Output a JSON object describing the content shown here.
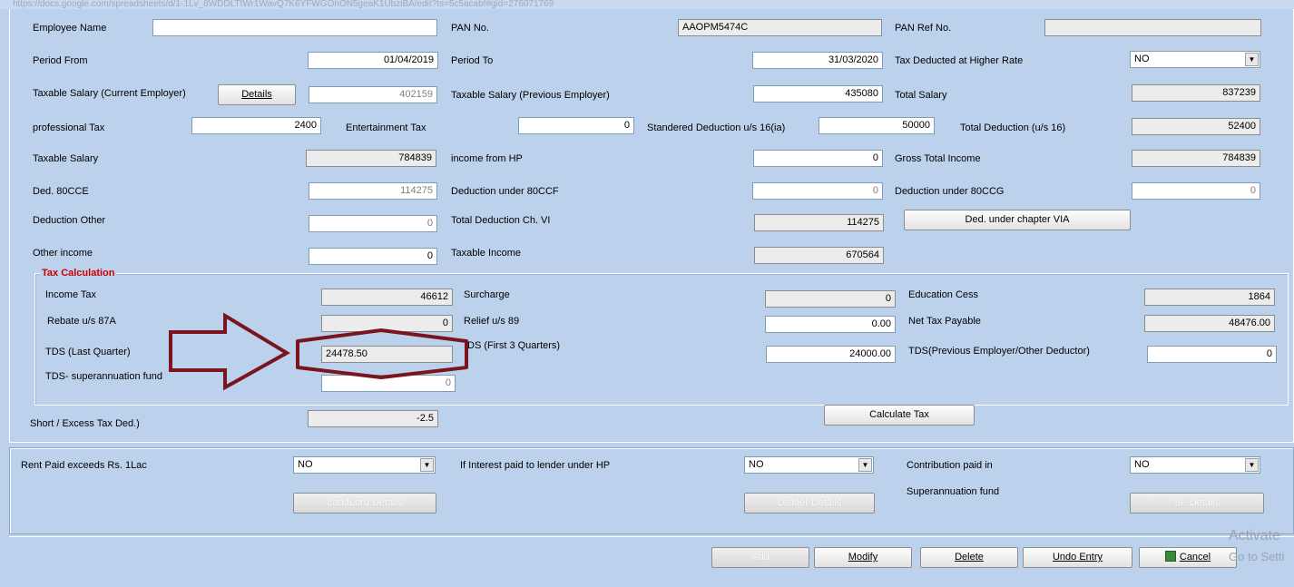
{
  "url": "https://docs.google.com/spreadsheets/d/1-1Lv_8WDDLTtWr1WavQ7K6YFWGOnON5geaK1UbziBA/edit?ts=5c5acabf#gid=276071769",
  "employee": {
    "name_label": "Employee Name",
    "name_value": "",
    "pan_label": "PAN No.",
    "pan_value": "AAOPM5474C",
    "pan_ref_label": "PAN Ref No.",
    "pan_ref_value": ""
  },
  "period": {
    "from_label": "Period From",
    "from_value": "01/04/2019",
    "to_label": "Period To",
    "to_value": "31/03/2020",
    "higher_rate_label": "Tax Deducted at Higher Rate",
    "higher_rate_value": "NO"
  },
  "salary": {
    "current_label": "Taxable Salary (Current Employer)",
    "details_button": "Details",
    "current_value": "402159",
    "previous_label": "Taxable Salary (Previous Employer)",
    "previous_value": "435080",
    "total_label": "Total Salary",
    "total_value": "837239"
  },
  "deductions16": {
    "prof_tax_label": "professional Tax",
    "prof_tax_value": "2400",
    "ent_tax_label": "Entertainment Tax",
    "ent_tax_value": "0",
    "std_label": "Standered Deduction u/s 16(ia)",
    "std_value": "50000",
    "total_label": "Total Deduction (u/s 16)",
    "total_value": "52400"
  },
  "income": {
    "taxable_salary_label": "Taxable Salary",
    "taxable_salary_value": "784839",
    "hp_label": "income from HP",
    "hp_value": "0",
    "gross_label": "Gross Total Income",
    "gross_value": "784839"
  },
  "chapter6": {
    "ccd_label": "Ded. 80CCE",
    "ccd_value": "114275",
    "ccf_label": "Deduction under 80CCF",
    "ccf_value": "0",
    "ccg_label": "Deduction under 80CCG",
    "ccg_value": "0",
    "other_label": "Deduction Other",
    "other_value": "0",
    "total_label": "Total Deduction Ch. VI",
    "total_value": "114275",
    "via_button": "Ded. under chapter VIA",
    "other_income_label": "Other income",
    "other_income_value": "0",
    "taxable_income_label": "Taxable Income",
    "taxable_income_value": "670564"
  },
  "tax_calc": {
    "title": "Tax Calculation",
    "income_tax_label": "Income Tax",
    "income_tax_value": "46612",
    "surcharge_label": "Surcharge",
    "surcharge_value": "0",
    "cess_label": "Education Cess",
    "cess_value": "1864",
    "rebate_label": "Rebate u/s 87A",
    "rebate_value": "0",
    "relief_label": "Relief u/s 89",
    "relief_value": "0.00",
    "net_tax_label": "Net Tax Payable",
    "net_tax_value": "48476.00",
    "tds_last_label": "TDS (Last Quarter)",
    "tds_last_value": "24478.50",
    "tds_first3_label": "DS (First 3 Quarters)",
    "tds_first3_value": "24000.00",
    "tds_prev_label": "TDS(Previous Employer/Other Deductor)",
    "tds_prev_value": "0",
    "tds_super_label": "TDS- superannuation fund",
    "tds_super_value": "0"
  },
  "short_excess_label": "Short / Excess Tax Ded.)",
  "short_excess_value": "-2.5",
  "calculate_button": "Calculate Tax",
  "extras": {
    "rent_label": "Rent Paid exceeds Rs. 1Lac",
    "rent_value": "NO",
    "landlord_button": "LandLord Details",
    "interest_label": "If Interest paid to lender under HP",
    "interest_value": "NO",
    "lender_button": "Lender Details",
    "contribution_label": "Contribution paid in",
    "superannuation_label": "Superannuation fund",
    "contribution_value": "NO",
    "sf_button": "SF Details"
  },
  "actions": {
    "add": "Add",
    "modify": "Modify",
    "delete": "Delete",
    "undo": "Undo Entry",
    "cancel": "Cancel"
  },
  "watermark": {
    "line1": "Activate",
    "line2": "Go to Setti"
  },
  "colors": {
    "background": "#bcd2ec",
    "annotation_arrow": "#7a1520",
    "group_title": "#cc0000"
  }
}
